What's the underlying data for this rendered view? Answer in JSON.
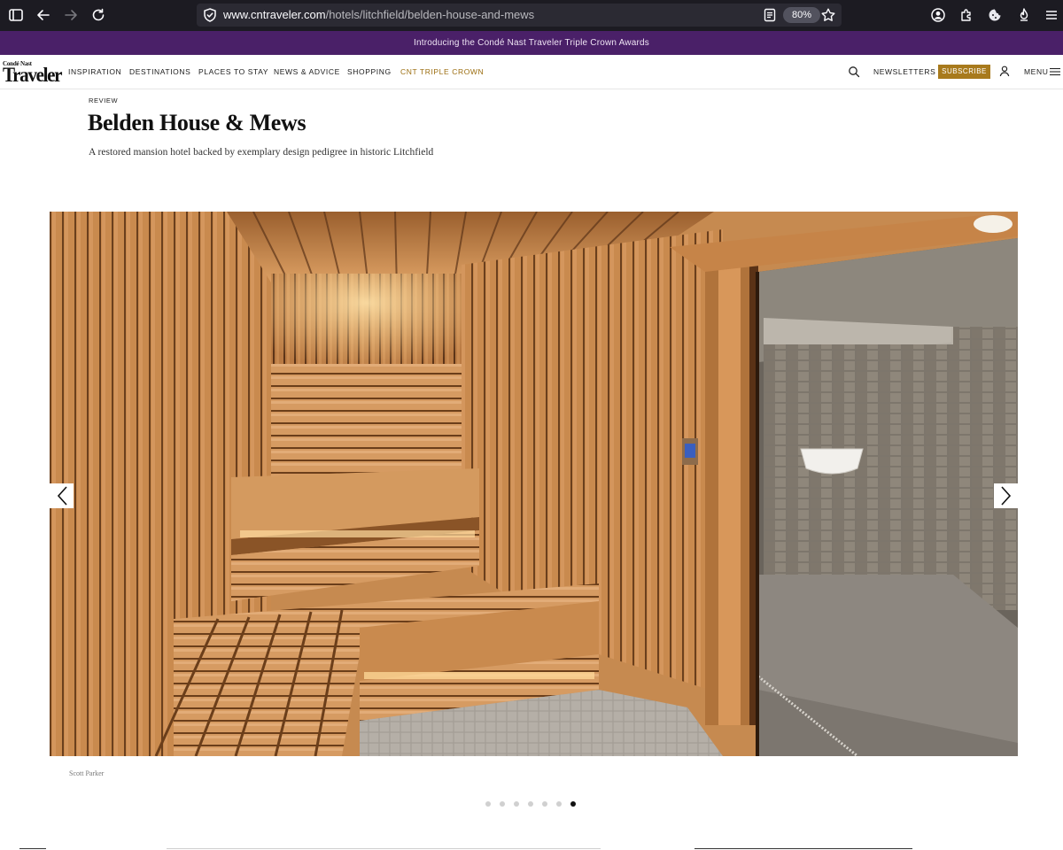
{
  "browser": {
    "url_host": "www.cntraveler.com",
    "url_path": "/hotels/litchfield/belden-house-and-mews",
    "zoom": "80%"
  },
  "promo": {
    "text": "Introducing the Condé Nast Traveler Triple Crown Awards"
  },
  "site": {
    "logo_small": "Condé Nast",
    "logo_big": "Traveler",
    "nav": [
      {
        "label": "INSPIRATION"
      },
      {
        "label": "DESTINATIONS"
      },
      {
        "label": "PLACES TO STAY"
      },
      {
        "label": "NEWS & ADVICE"
      },
      {
        "label": "SHOPPING"
      },
      {
        "label": "CNT TRIPLE CROWN"
      }
    ],
    "newsletters": "NEWSLETTERS",
    "subscribe": "SUBSCRIBE",
    "menu": "MENU"
  },
  "article": {
    "tag": "REVIEW",
    "title": "Belden House & Mews",
    "dek": "A restored mansion hotel backed by exemplary design pedigree in historic Litchfield"
  },
  "gallery": {
    "credit": "Scott Parker",
    "slide_count": 7,
    "active_index": 7
  },
  "colors": {
    "promo_bg": "#4a2068",
    "accent_gold": "#a87a1c",
    "browser_bg": "#1c1b22"
  }
}
